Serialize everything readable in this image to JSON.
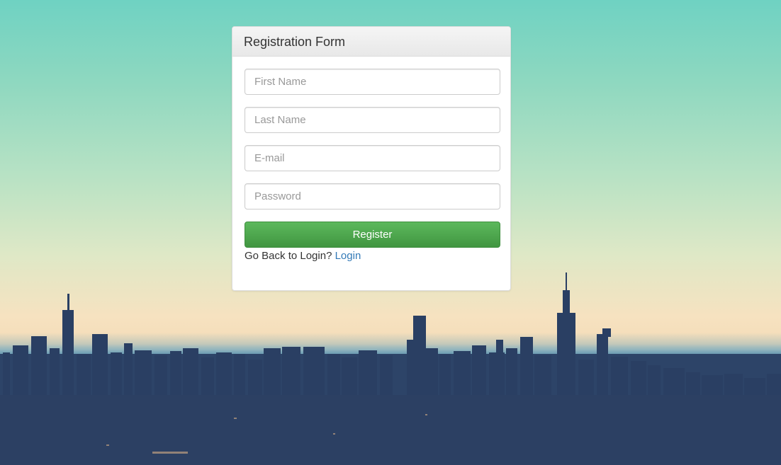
{
  "form": {
    "title": "Registration Form",
    "fields": {
      "first_name_placeholder": "First Name",
      "last_name_placeholder": "Last Name",
      "email_placeholder": "E-mail",
      "password_placeholder": "Password"
    },
    "register_label": "Register",
    "back_text": "Go Back to Login?",
    "login_link": "Login"
  },
  "colors": {
    "button_green": "#5cb85c",
    "link_blue": "#337ab7"
  }
}
